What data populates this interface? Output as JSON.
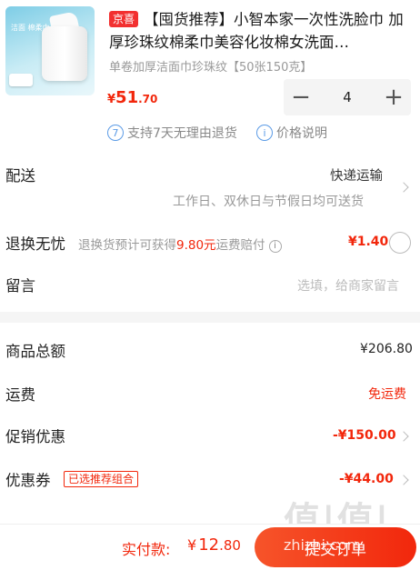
{
  "product": {
    "badge": "京喜",
    "title": "【囤货推荐】小智本家一次性洗脸巾 加厚珍珠纹棉柔巾美容化妆棉女洗面…",
    "image_label": "洁面 棉柔巾",
    "spec": "单卷加厚洁面巾珍珠纹【50张150克】",
    "price_currency": "¥",
    "price_int": "51",
    "price_dec": ".70",
    "quantity": "4",
    "minus_glyph": "−",
    "plus_glyph": "+",
    "services": [
      {
        "icon_text": "7",
        "label": "支持7天无理由退货"
      },
      {
        "icon_text": "i",
        "label": "价格说明"
      }
    ]
  },
  "delivery": {
    "label": "配送",
    "method": "快递运输",
    "note": "工作日、双休日与节假日均可送货"
  },
  "return_insurance": {
    "label": "退换无忧",
    "desc_prefix": "退换货预计可获得",
    "desc_amount": "9.80元",
    "desc_suffix": "运费赔付",
    "price": "¥1.40"
  },
  "message": {
    "label": "留言",
    "placeholder": "选填，给商家留言"
  },
  "summary": {
    "total_label": "商品总额",
    "total_value": "¥206.80",
    "shipping_label": "运费",
    "shipping_value": "免运费",
    "promo_label": "促销优惠",
    "promo_value": "-¥150.00",
    "coupon_label": "优惠券",
    "coupon_tag": "已选推荐组合",
    "coupon_value": "-¥44.00"
  },
  "footer": {
    "pay_label": "实付款:",
    "pay_currency": "¥",
    "pay_int": "12",
    "pay_dec": ".80",
    "submit_label": "提交订单"
  },
  "watermark": {
    "text": "值|值|值",
    "site": "zhizhi.com"
  },
  "colors": {
    "accent": "#f2270c",
    "link_blue": "#5b9be6",
    "divider_bg": "#f5f5f5"
  }
}
